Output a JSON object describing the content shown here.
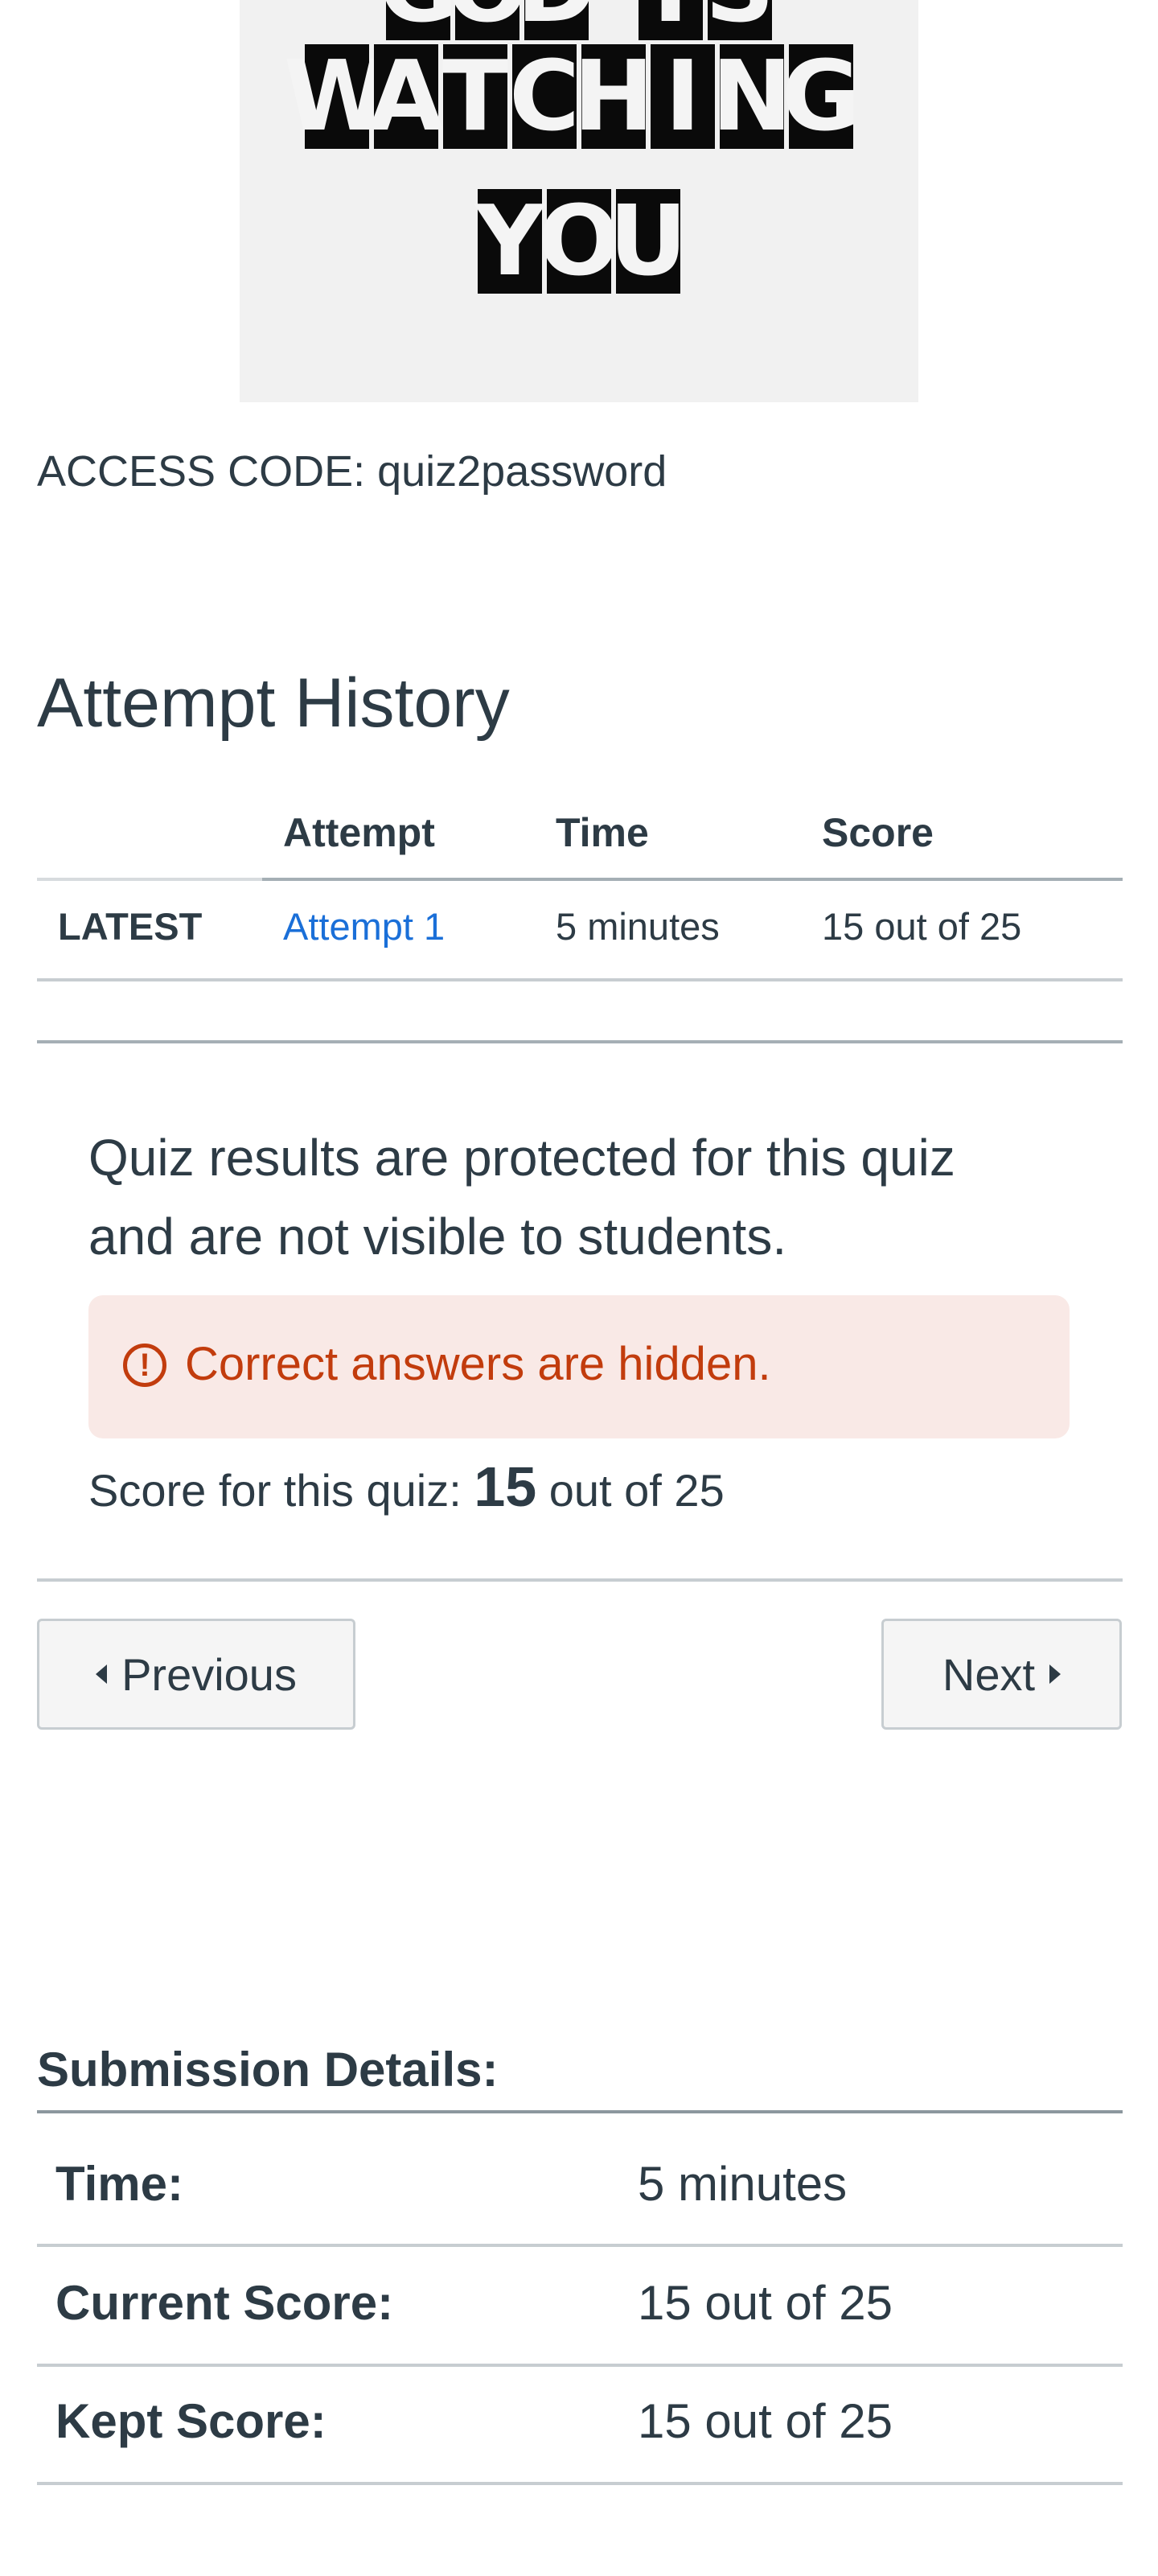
{
  "poster": {
    "lines": [
      "GOD IS",
      "WATCHING",
      "YOU"
    ]
  },
  "access_code": "ACCESS CODE: quiz2password",
  "attempt_history": {
    "title": "Attempt History",
    "headers": [
      "",
      "Attempt",
      "Time",
      "Score"
    ],
    "rows": [
      {
        "label": "LATEST",
        "attempt": "Attempt 1",
        "time": "5 minutes",
        "score": "15 out of 25"
      }
    ]
  },
  "results": {
    "message": "Quiz results are protected for this quiz and are not visible to students.",
    "alert": "Correct answers are hidden.",
    "score_prefix": "Score for this quiz:",
    "score_value": "15",
    "score_suffix": "out of 25"
  },
  "nav": {
    "previous": "Previous",
    "next": "Next"
  },
  "submission": {
    "title": "Submission Details:",
    "rows": [
      {
        "label": "Time:",
        "value": "5 minutes"
      },
      {
        "label": "Current Score:",
        "value": "15 out of 25"
      },
      {
        "label": "Kept Score:",
        "value": "15 out of 25"
      }
    ]
  },
  "colors": {
    "text": "#2d3b45",
    "link": "#1a6fd8",
    "alert_text": "#c23c0d",
    "alert_bg": "#f9e9e6"
  }
}
